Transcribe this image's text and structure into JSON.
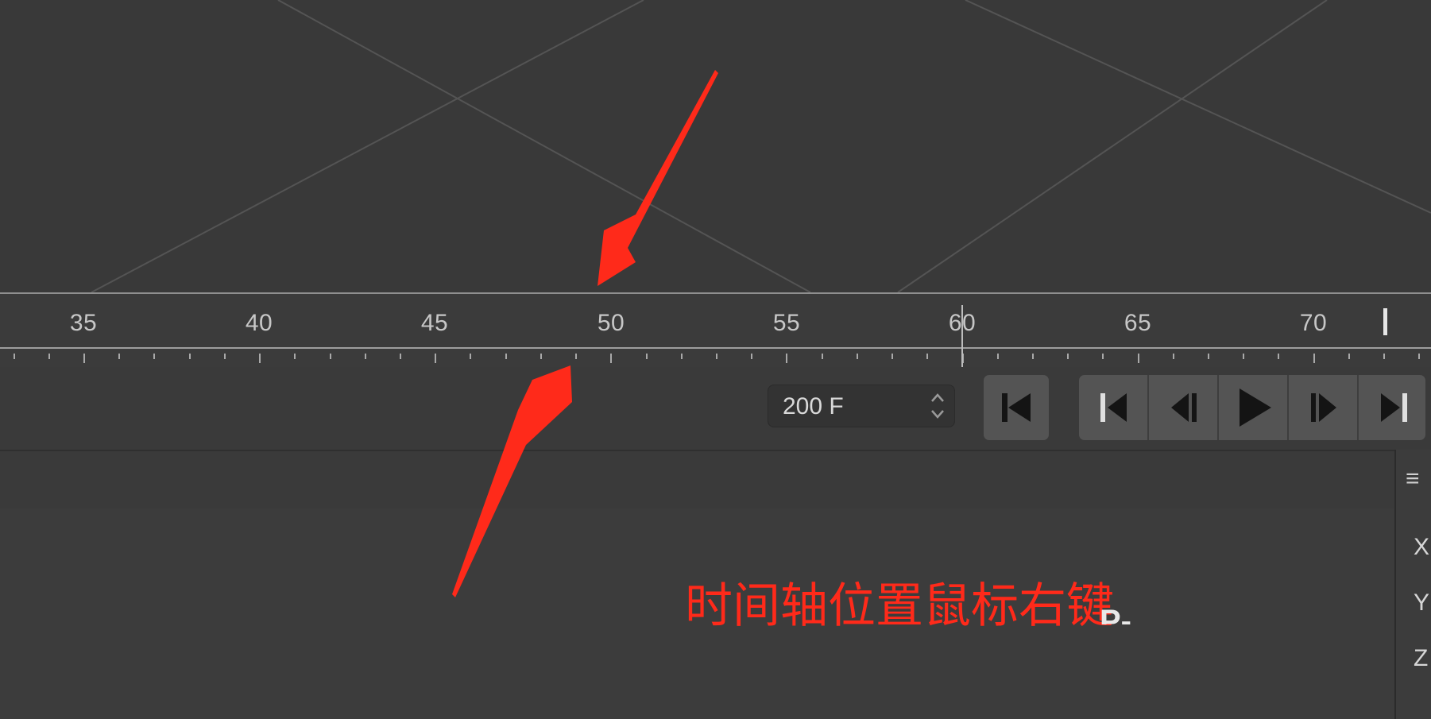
{
  "timeline": {
    "labels": [
      {
        "text": "35"
      },
      {
        "text": "40"
      },
      {
        "text": "45"
      },
      {
        "text": "50"
      },
      {
        "text": "55"
      },
      {
        "text": "60"
      },
      {
        "text": "65"
      },
      {
        "text": "70"
      }
    ],
    "current_frame": 60
  },
  "transport": {
    "frame_field_value": "200 F",
    "buttons": [
      {
        "name": "go-to-start"
      },
      {
        "name": "go-to-start"
      },
      {
        "name": "previous-key"
      },
      {
        "name": "play"
      },
      {
        "name": "next-key"
      },
      {
        "name": "go-to-end"
      }
    ]
  },
  "side_panel": {
    "menu_icon": "hamburger-icon",
    "axes": [
      "X",
      "Y",
      "Z"
    ]
  },
  "annotation": {
    "text": "时间轴位置鼠标右键",
    "color": "#ff2a1a",
    "stray_text": "P-"
  },
  "colors": {
    "background": "#3a3a3a",
    "annotation_arrow": "#ff2a1a"
  }
}
